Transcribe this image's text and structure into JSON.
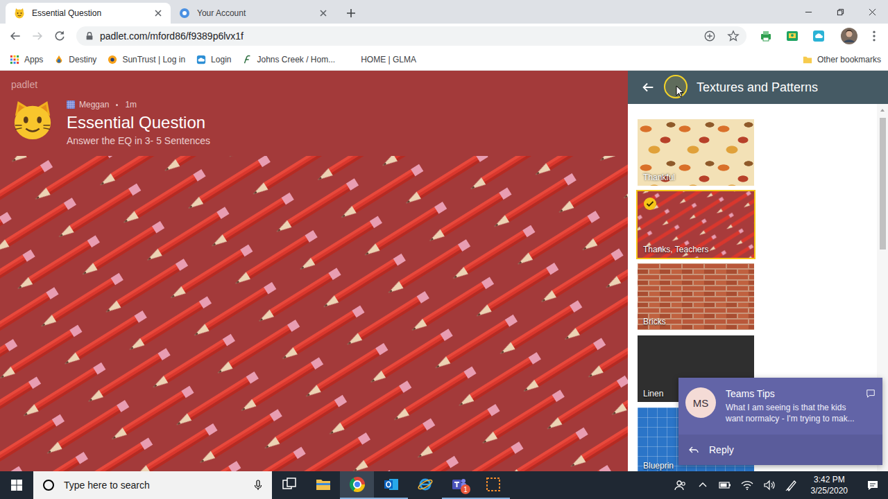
{
  "browser": {
    "tabs": [
      {
        "title": "Essential Question",
        "kind": "padlet",
        "selected": true
      },
      {
        "title": "Your Account",
        "kind": "account",
        "selected": false
      }
    ],
    "address": "padlet.com/mford86/f9389p6lvx1f",
    "bookmarks": [
      {
        "label": "Apps",
        "kind": "grid"
      },
      {
        "label": "Destiny",
        "kind": "drop"
      },
      {
        "label": "SunTrust | Log in",
        "kind": "sun"
      },
      {
        "label": "Login",
        "kind": "cloud"
      },
      {
        "label": "Johns Creek / Hom...",
        "kind": "script"
      },
      {
        "label": "HOME | GLMA",
        "kind": "blank"
      }
    ],
    "other_bookmarks": "Other bookmarks"
  },
  "padlet": {
    "brand": "padlet",
    "author": "Meggan",
    "age": "1m",
    "title": "Essential Question",
    "description": "Answer the EQ in 3- 5 Sentences"
  },
  "panel": {
    "title": "Textures and Patterns",
    "textures": [
      {
        "name": "Thankful",
        "kind": "leaves",
        "selected": false
      },
      {
        "name": "Thanks, Teachers",
        "kind": "pencils",
        "selected": true
      },
      {
        "name": "Bricks",
        "kind": "bricks",
        "selected": false
      },
      {
        "name": "Linen",
        "kind": "linen",
        "selected": false
      },
      {
        "name": "Blueprin",
        "kind": "blueprint",
        "selected": false
      }
    ]
  },
  "notification": {
    "initials": "MS",
    "title": "Teams Tips",
    "message": "What I am seeing is that the kids want normalcy - I'm trying to mak...",
    "action": "Reply"
  },
  "taskbar": {
    "search_placeholder": "Type here to search",
    "apps": [
      {
        "kind": "taskview",
        "open": false,
        "badge": ""
      },
      {
        "kind": "explorer",
        "open": false,
        "badge": ""
      },
      {
        "kind": "chrome",
        "open": true,
        "badge": ""
      },
      {
        "kind": "outlook",
        "open": true,
        "badge": ""
      },
      {
        "kind": "ie",
        "open": false,
        "badge": ""
      },
      {
        "kind": "teams",
        "open": true,
        "badge": "1"
      },
      {
        "kind": "snip",
        "open": true,
        "badge": ""
      }
    ],
    "time": "3:42 PM",
    "date": "3/25/2020"
  }
}
